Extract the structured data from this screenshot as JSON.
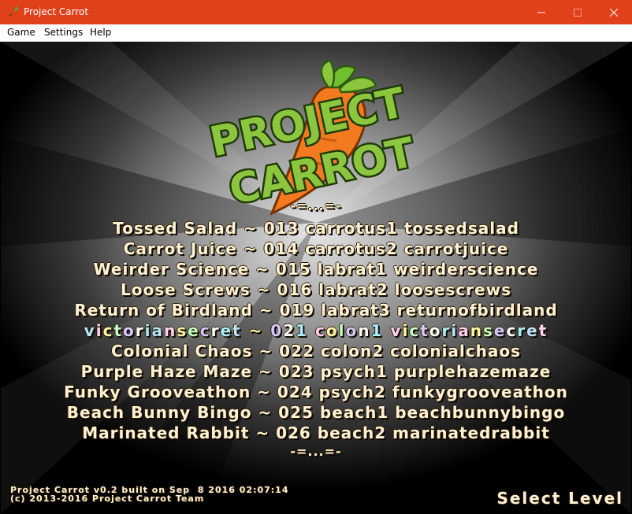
{
  "window": {
    "title": "Project Carrot",
    "icon": "carrot-icon",
    "titlebar_color": "#e0401a"
  },
  "menubar": {
    "items": [
      {
        "label": "Game"
      },
      {
        "label": "Settings"
      },
      {
        "label": "Help"
      }
    ]
  },
  "logo": {
    "line1": "PROJECT",
    "line2": "CARROT"
  },
  "menu": {
    "separator": "-=...=-",
    "selected_index": 5,
    "levels": [
      {
        "text": "Tossed Salad ~ 013 carrotus1 tossedsalad"
      },
      {
        "text": "Carrot Juice ~ 014 carrotus2 carrotjuice"
      },
      {
        "text": "Weirder Science ~ 015 labrat1 weirderscience"
      },
      {
        "text": "Loose Screws ~ 016 labrat2 loosescrews"
      },
      {
        "text": "Return of Birdland ~ 019 labrat3 returnofbirdland"
      },
      {
        "text": "victoriansecret ~ 021 colon1 victoriansecret"
      },
      {
        "text": "Colonial Chaos ~ 022 colon2 colonialchaos"
      },
      {
        "text": "Purple Haze Maze ~ 023 psych1 purplehazemaze"
      },
      {
        "text": "Funky Grooveathon ~ 024 psych2 funkygrooveathon"
      },
      {
        "text": "Beach Bunny Bingo ~ 025 beach1 beachbunnybingo"
      },
      {
        "text": "Marinated Rabbit ~ 026 beach2 marinatedrabbit"
      }
    ]
  },
  "footer": {
    "build_line": "Project Carrot v0.2 built on Sep  8 2016 02:07:14",
    "copyright_line": "(c) 2013-2016 Project Carrot Team",
    "action_label": "Select Level"
  },
  "colors": {
    "menu_text": "#fff1d6",
    "logo_green": "#8cc63f",
    "logo_orange": "#f47a20"
  }
}
